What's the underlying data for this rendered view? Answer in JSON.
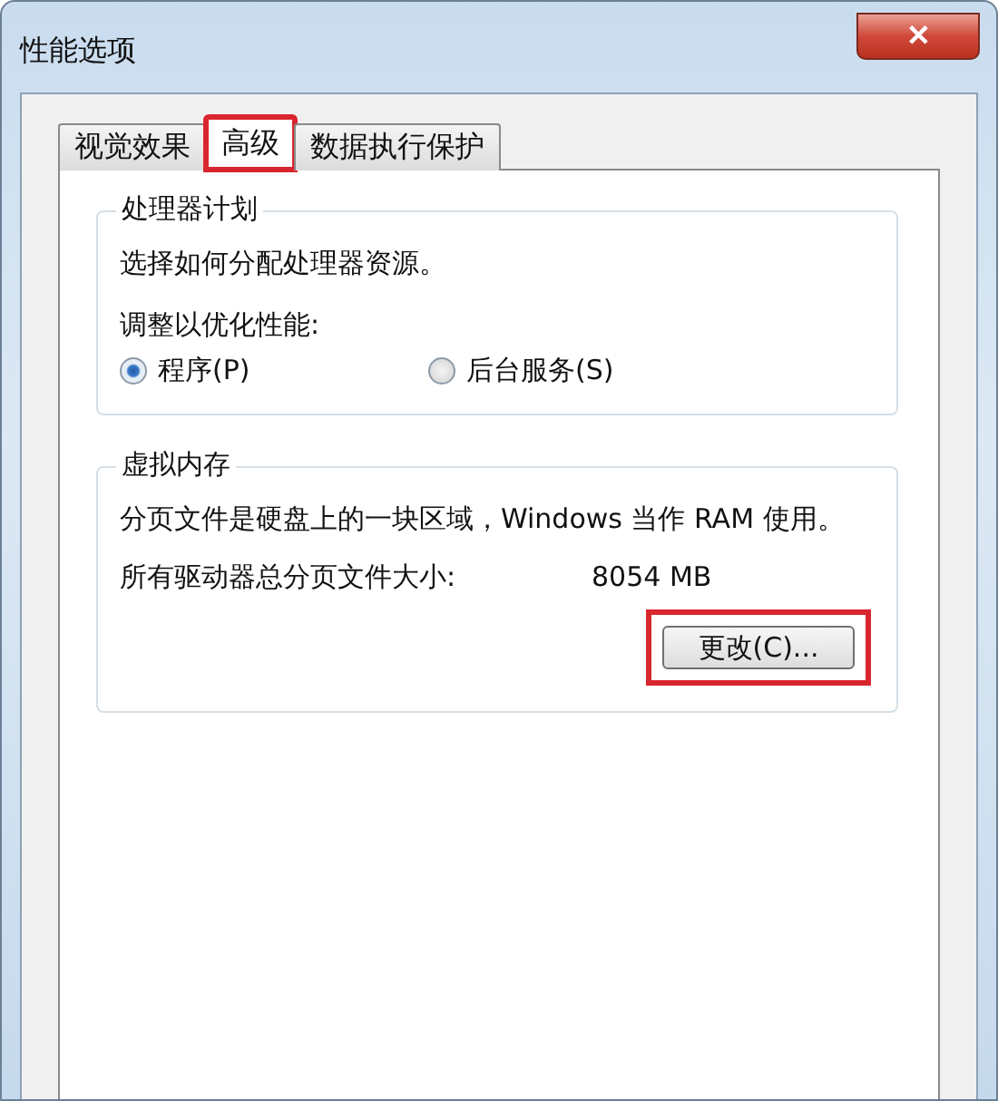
{
  "window": {
    "title": "性能选项",
    "close": "✕"
  },
  "tabs": [
    {
      "label": "视觉效果",
      "selected": false,
      "highlighted": false
    },
    {
      "label": "高级",
      "selected": true,
      "highlighted": true
    },
    {
      "label": "数据执行保护",
      "selected": false,
      "highlighted": false
    }
  ],
  "processor_group": {
    "title": "处理器计划",
    "description": "选择如何分配处理器资源。",
    "prompt": "调整以优化性能:",
    "options": [
      {
        "label": "程序(P)",
        "selected": true
      },
      {
        "label": "后台服务(S)",
        "selected": false
      }
    ]
  },
  "memory_group": {
    "title": "虚拟内存",
    "description": "分页文件是硬盘上的一块区域，Windows 当作 RAM 使用。",
    "size_label": "所有驱动器总分页文件大小:",
    "size_value": "8054 MB",
    "button": {
      "label": "更改(C)...",
      "highlighted": true
    }
  }
}
